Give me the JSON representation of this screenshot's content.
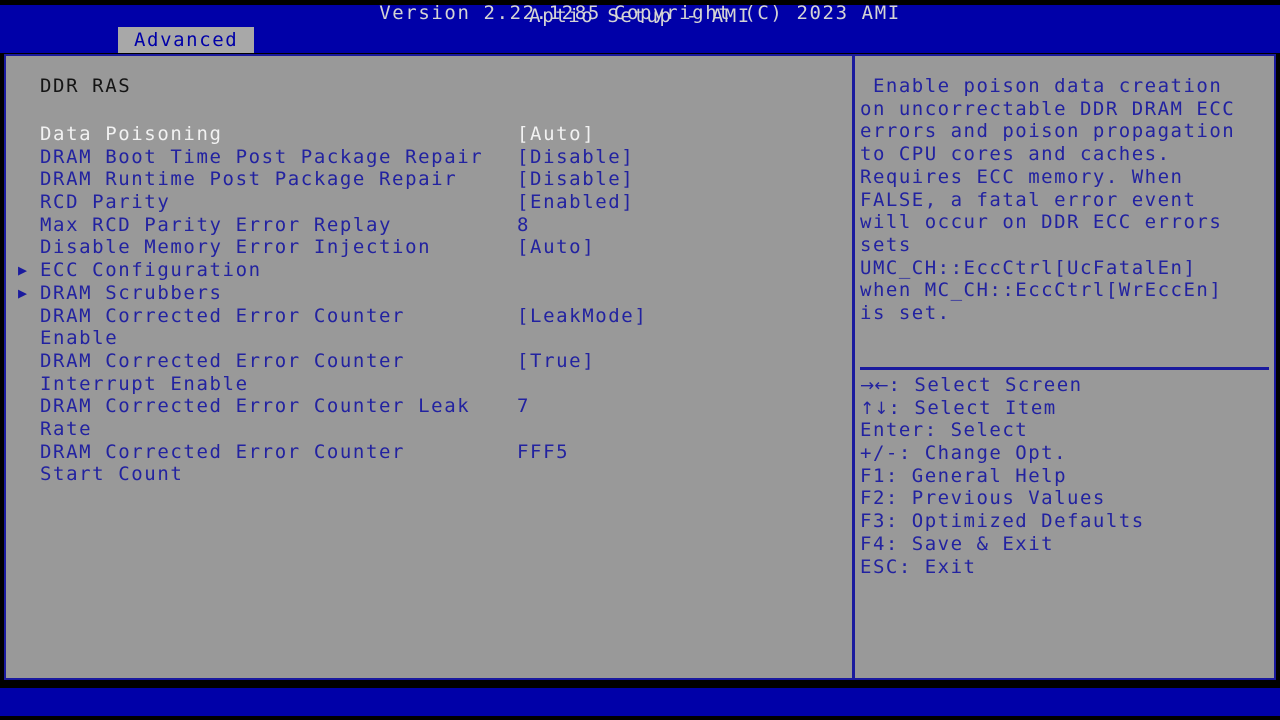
{
  "header": {
    "app_title": "Aptio Setup - AMI",
    "tabs": [
      {
        "label": "Advanced",
        "active": true
      }
    ]
  },
  "main": {
    "section_title": "DDR RAS",
    "options": [
      {
        "label": "Data Poisoning",
        "value": "[Auto]",
        "submenu": false,
        "selected": true
      },
      {
        "label": "DRAM Boot Time Post Package Repair",
        "value": "[Disable]",
        "submenu": false,
        "selected": false
      },
      {
        "label": "DRAM Runtime Post Package Repair",
        "value": "[Disable]",
        "submenu": false,
        "selected": false
      },
      {
        "label": "RCD Parity",
        "value": "[Enabled]",
        "submenu": false,
        "selected": false
      },
      {
        "label": "Max RCD Parity Error Replay",
        "value": "8",
        "submenu": false,
        "selected": false
      },
      {
        "label": "Disable Memory Error Injection",
        "value": "[Auto]",
        "submenu": false,
        "selected": false
      },
      {
        "label": "ECC Configuration",
        "value": "",
        "submenu": true,
        "selected": false
      },
      {
        "label": "DRAM Scrubbers",
        "value": "",
        "submenu": true,
        "selected": false
      },
      {
        "label": "DRAM Corrected Error Counter",
        "value": "[LeakMode]",
        "submenu": false,
        "selected": false
      },
      {
        "label": "Enable",
        "value": "",
        "submenu": false,
        "selected": false
      },
      {
        "label": "DRAM Corrected Error Counter",
        "value": "[True]",
        "submenu": false,
        "selected": false
      },
      {
        "label": "Interrupt Enable",
        "value": "",
        "submenu": false,
        "selected": false
      },
      {
        "label": "DRAM Corrected Error Counter Leak",
        "value": "7",
        "submenu": false,
        "selected": false
      },
      {
        "label": "Rate",
        "value": "",
        "submenu": false,
        "selected": false
      },
      {
        "label": "DRAM Corrected Error Counter",
        "value": "FFF5",
        "submenu": false,
        "selected": false
      },
      {
        "label": "Start Count",
        "value": "",
        "submenu": false,
        "selected": false
      }
    ]
  },
  "help": {
    "lines": [
      " Enable poison data creation",
      "on uncorrectable DDR DRAM ECC",
      "errors and poison propagation",
      "to CPU cores and caches.",
      "Requires ECC memory. When",
      "FALSE, a fatal error event",
      "will occur on DDR ECC errors",
      "sets",
      "UMC_CH::EccCtrl[UcFatalEn]",
      "when MC_CH::EccCtrl[WrEccEn]",
      "is set."
    ]
  },
  "keys": [
    {
      "glyph": "→←",
      "text": ": Select Screen"
    },
    {
      "glyph": "↑↓",
      "text": ": Select Item"
    },
    {
      "glyph": "",
      "text": "Enter: Select"
    },
    {
      "glyph": "",
      "text": "+/-: Change Opt."
    },
    {
      "glyph": "",
      "text": "F1: General Help"
    },
    {
      "glyph": "",
      "text": "F2: Previous Values"
    },
    {
      "glyph": "",
      "text": "F3: Optimized Defaults"
    },
    {
      "glyph": "",
      "text": "F4: Save & Exit"
    },
    {
      "glyph": "",
      "text": "ESC: Exit"
    }
  ],
  "footer": {
    "version_text": "Version 2.22.1285 Copyright (C) 2023 AMI"
  },
  "colors": {
    "background": "#000000",
    "bar_blue": "#0000a8",
    "panel_gray": "#999999",
    "text_blue": "#2222a0",
    "text_selected": "#f2f2f2",
    "text_heading": "#141414",
    "border_blue": "#1a1a9e",
    "bar_text": "#d4d4d4"
  }
}
